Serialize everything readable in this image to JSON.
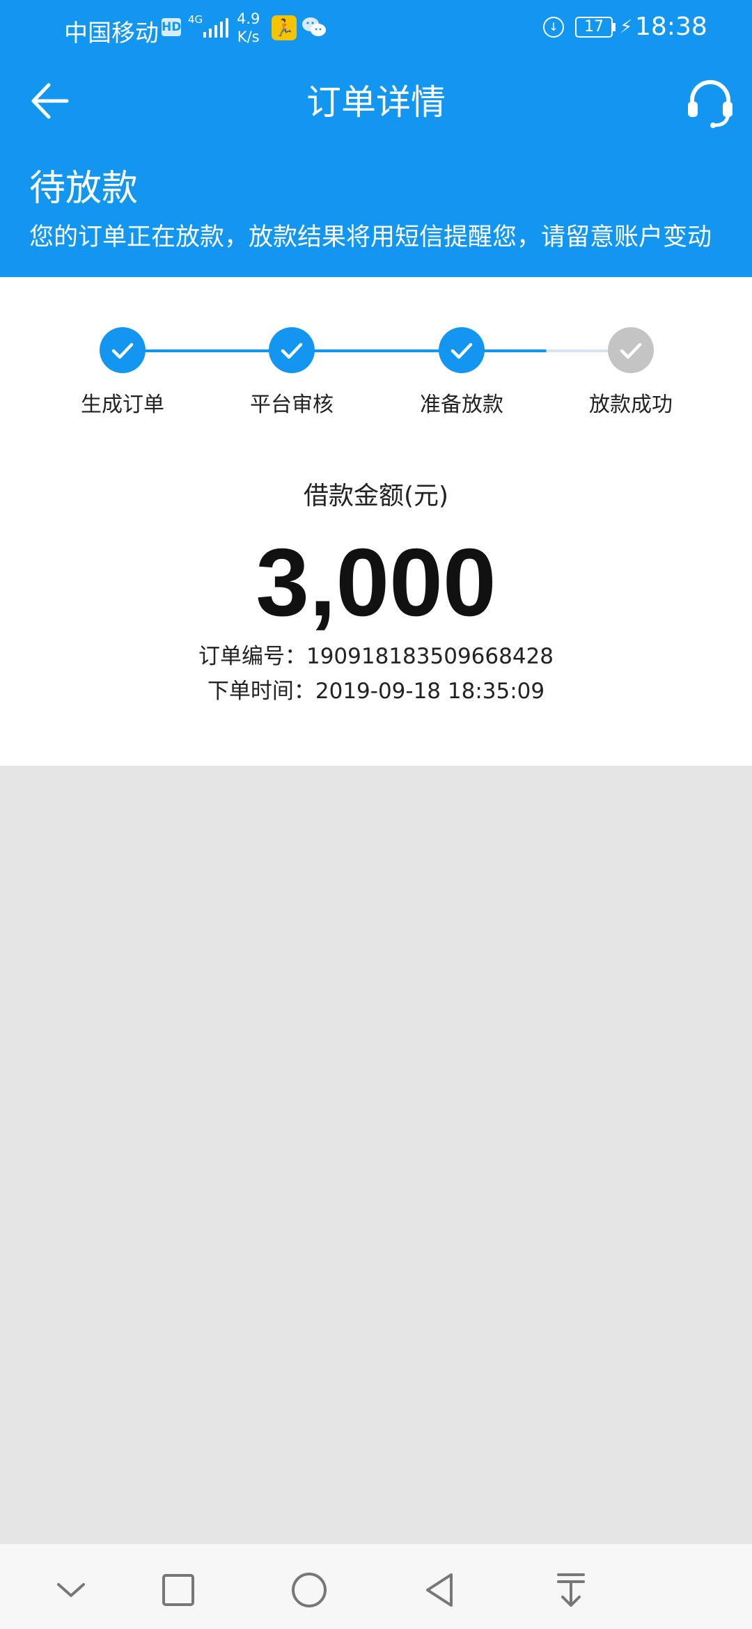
{
  "status_bar": {
    "carrier": "中国移动",
    "hd_badge": "HD",
    "network": "4G",
    "speed_value": "4.9",
    "speed_unit": "K/s",
    "battery": "17",
    "time": "18:38"
  },
  "nav": {
    "title": "订单详情",
    "back_icon": "arrow-left-icon",
    "service_icon": "headset-icon"
  },
  "order_status": {
    "title": "待放款",
    "description": "您的订单正在放款，放款结果将用短信提醒您，请留意账户变动"
  },
  "steps": [
    {
      "label": "生成订单",
      "done": true
    },
    {
      "label": "平台审核",
      "done": true
    },
    {
      "label": "准备放款",
      "done": true
    },
    {
      "label": "放款成功",
      "done": false
    }
  ],
  "loan": {
    "amount_label": "借款金额(元)",
    "amount": "3,000",
    "order_no_label": "订单编号：",
    "order_no": "190918183509668428",
    "order_time_label": "下单时间：",
    "order_time": "2019-09-18 18:35:09"
  },
  "colors": {
    "primary": "#1296f0",
    "step_done": "#1296f0",
    "step_pending": "#c4c4c4",
    "background": "#e5e5e5"
  },
  "bottom_nav": {
    "icons": [
      "chevron-down-icon",
      "square-icon",
      "circle-home-icon",
      "triangle-back-icon",
      "download-icon"
    ]
  }
}
